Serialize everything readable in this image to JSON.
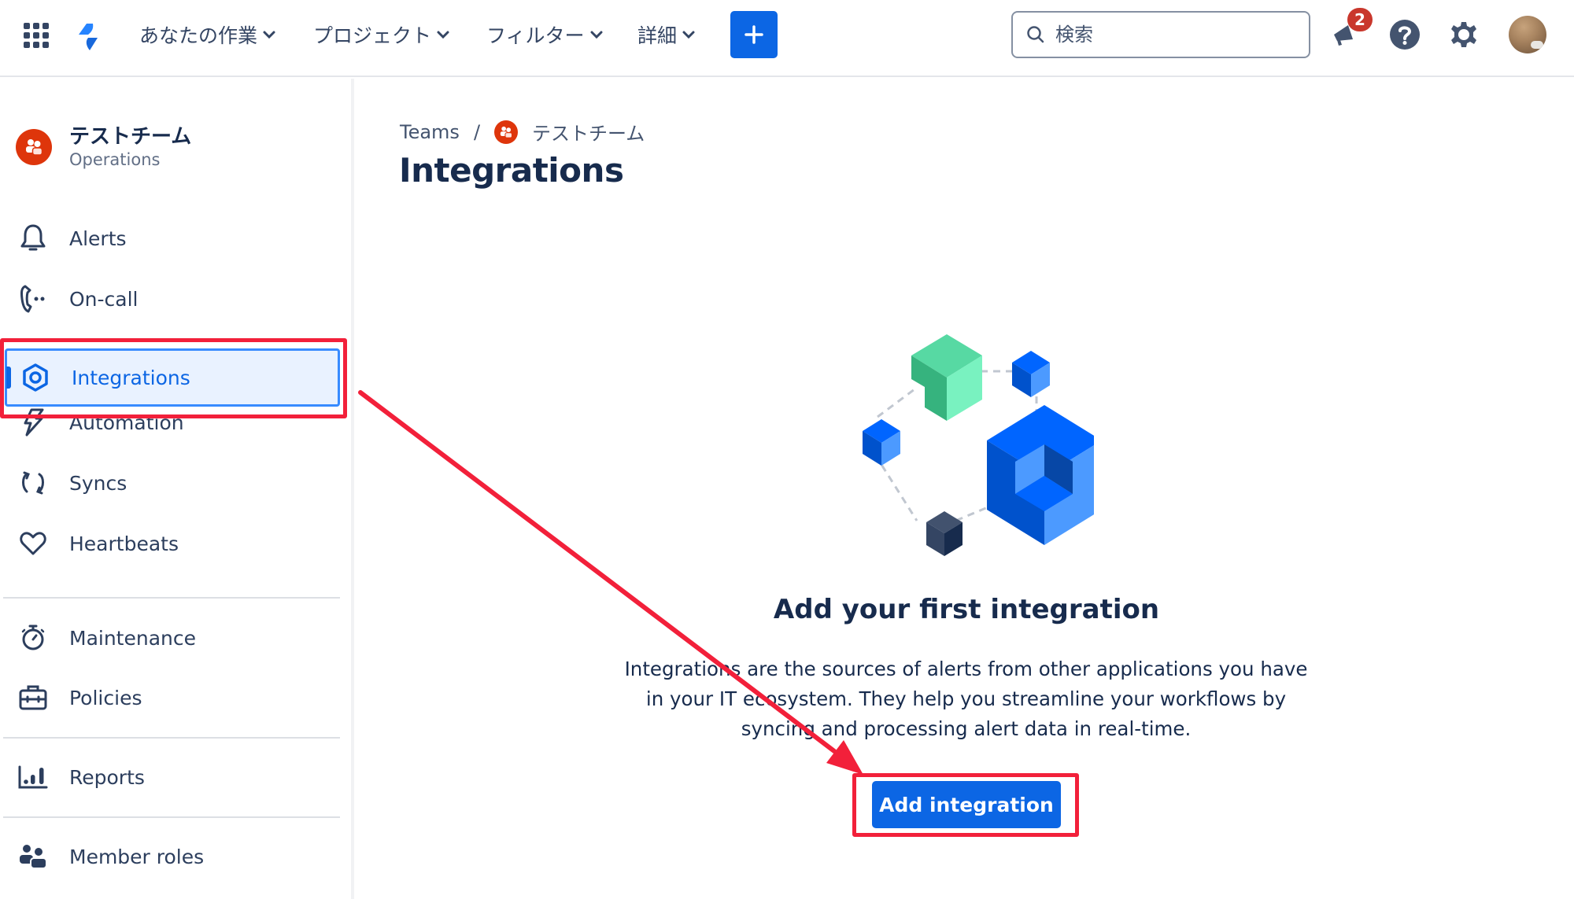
{
  "topnav": {
    "apps_icon": "grid-icon",
    "logo": "jira-logo",
    "menus": [
      {
        "label": "あなたの作業"
      },
      {
        "label": "プロジェクト"
      },
      {
        "label": "フィルター"
      },
      {
        "label": "詳細"
      }
    ],
    "create_label": "+",
    "search": {
      "placeholder": "検索",
      "value": ""
    },
    "notifications": {
      "count": "2"
    },
    "help_icon": "question-icon",
    "settings_icon": "gear-icon"
  },
  "sidebar": {
    "team": {
      "name": "テストチーム",
      "type": "Operations"
    },
    "items": [
      {
        "label": "Alerts",
        "icon": "bell-icon"
      },
      {
        "label": "On-call",
        "icon": "phone-icon"
      },
      {
        "label": "Integrations",
        "icon": "hexagon-icon",
        "selected": true
      },
      {
        "label": "Automation",
        "icon": "lightning-icon"
      },
      {
        "label": "Syncs",
        "icon": "sync-icon"
      },
      {
        "label": "Heartbeats",
        "icon": "heart-icon"
      },
      {
        "label": "Maintenance",
        "icon": "stopwatch-icon"
      },
      {
        "label": "Policies",
        "icon": "briefcase-icon"
      },
      {
        "label": "Reports",
        "icon": "bar-chart-icon"
      },
      {
        "label": "Member roles",
        "icon": "people-icon"
      }
    ]
  },
  "main": {
    "breadcrumb": {
      "root": "Teams",
      "separator": "/",
      "team": "テストチーム"
    },
    "title": "Integrations",
    "empty_state": {
      "heading": "Add your first integration",
      "description": "Integrations are the sources of alerts from other applications you have in your IT ecosystem. They help you streamline your workflows by syncing and processing alert data in real-time.",
      "button_label": "Add integration"
    }
  },
  "colors": {
    "brand_blue": "#0c66e4",
    "team_red": "#de350b",
    "annotation_red": "#f2203a",
    "badge_red": "#c9372c"
  }
}
